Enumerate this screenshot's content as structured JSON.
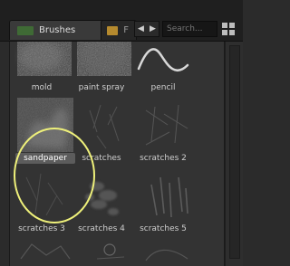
{
  "header": {
    "tabs": [
      {
        "label": "Brushes",
        "swatch_color": "#3f6a35"
      },
      {
        "label": "F",
        "swatch_color": "#b58a2e"
      }
    ],
    "nav_prev": "◀",
    "nav_next": "▶",
    "search": {
      "placeholder": "Search...",
      "value": ""
    }
  },
  "brushes": [
    {
      "label": "mold"
    },
    {
      "label": "paint spray"
    },
    {
      "label": "pencil"
    },
    {
      "label": "sandpaper",
      "selected": true
    },
    {
      "label": "scratches"
    },
    {
      "label": "scratches 2"
    },
    {
      "label": "scratches 3"
    },
    {
      "label": "scratches 4"
    },
    {
      "label": "scratches 5"
    }
  ],
  "colors": {
    "highlight_ring": "#eef07a",
    "selected_label_bg": "#5c5c5c"
  }
}
